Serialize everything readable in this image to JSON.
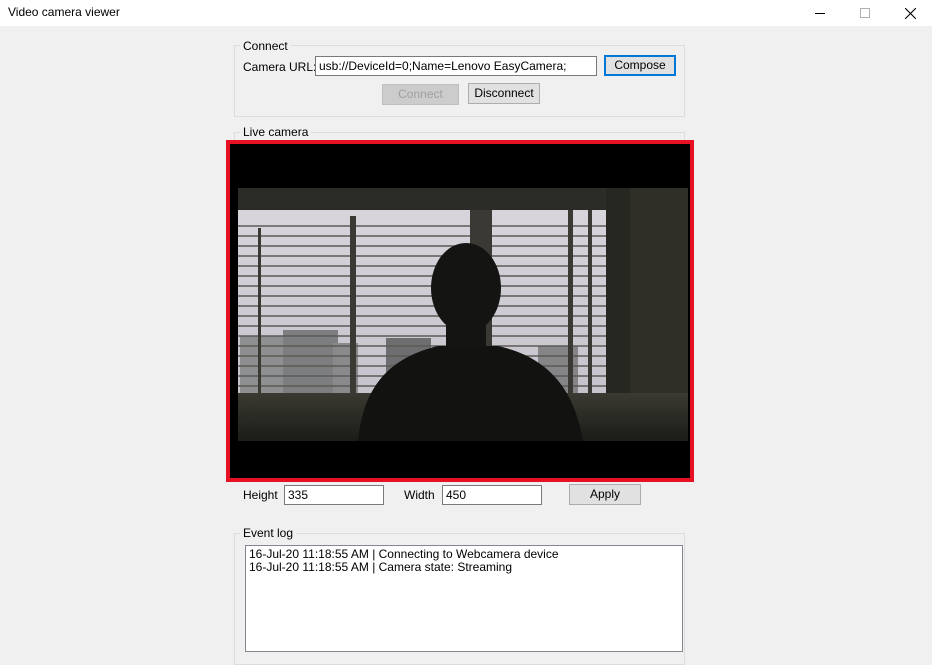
{
  "window": {
    "title": "Video camera viewer",
    "controls": [
      "minimize-icon",
      "maximize-icon",
      "close-icon"
    ]
  },
  "connect": {
    "group_label": "Connect",
    "camera_url_label": "Camera URL:",
    "camera_url_value": "usb://DeviceId=0;Name=Lenovo EasyCamera;",
    "compose_label": "Compose",
    "connect_label": "Connect",
    "disconnect_label": "Disconnect"
  },
  "live": {
    "group_label": "Live camera",
    "highlight_color": "#e81123"
  },
  "size": {
    "height_label": "Height",
    "height_value": "335",
    "width_label": "Width",
    "width_value": "450",
    "apply_label": "Apply"
  },
  "event_log": {
    "group_label": "Event log",
    "lines": [
      "16-Jul-20 11:18:55 AM | Connecting to Webcamera device",
      "16-Jul-20 11:18:55 AM | Camera state: Streaming"
    ]
  }
}
